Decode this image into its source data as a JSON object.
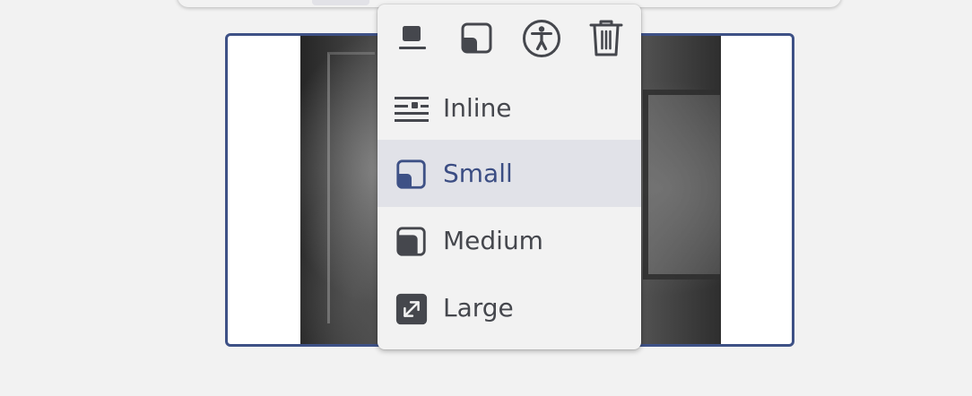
{
  "colors": {
    "accent": "#3e5186",
    "icon": "#45474d",
    "selected_bg": "#e1e2e8",
    "menu_bg": "#f2f2f2",
    "page_bg": "#f2f2f2"
  },
  "image_menu": {
    "toolbar_icons": [
      "align-bottom-icon",
      "size-small-icon",
      "accessibility-icon",
      "trash-icon"
    ],
    "items": [
      {
        "id": "inline",
        "label": "Inline",
        "icon": "inline-text-icon",
        "selected": false
      },
      {
        "id": "small",
        "label": "Small",
        "icon": "size-small-icon",
        "selected": true
      },
      {
        "id": "medium",
        "label": "Medium",
        "icon": "size-medium-icon",
        "selected": false
      },
      {
        "id": "large",
        "label": "Large",
        "icon": "expand-arrows-icon",
        "selected": false
      }
    ]
  }
}
